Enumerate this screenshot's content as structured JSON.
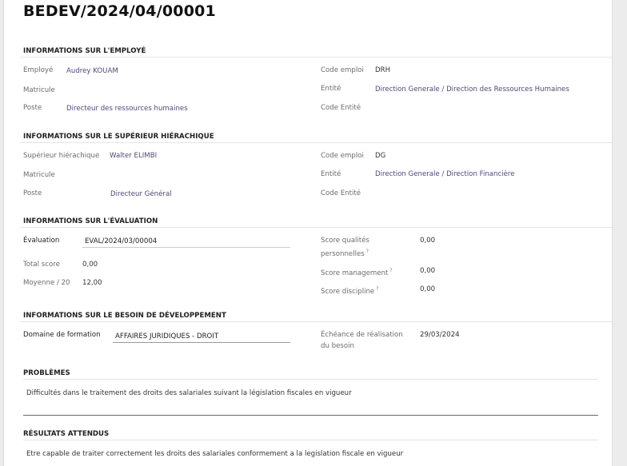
{
  "record_title": "BEDEV/2024/04/00001",
  "employee": {
    "heading": "INFORMATIONS SUR L'EMPLOYÉ",
    "employe_label": "Employé",
    "employe_value": "Audrey KOUAM",
    "matricule_label": "Matricule",
    "poste_label": "Poste",
    "poste_value": "Directeur des ressources humaines",
    "code_emploi_label": "Code emploi",
    "code_emploi_value": "DRH",
    "entite_label": "Entité",
    "entite_value": "Direction Generale / Direction des Ressources Humaines",
    "code_entite_label": "Code Entité"
  },
  "superior": {
    "heading": "INFORMATIONS SUR LE SUPÉRIEUR HIÉRACHIQUE",
    "sup_label": "Supérieur hiérachique",
    "sup_value": "Walter ELIMBI",
    "matricule_label": "Matricule",
    "poste_label": "Poste",
    "poste_value": "Directeur Général",
    "code_emploi_label": "Code emploi",
    "code_emploi_value": "DG",
    "entite_label": "Entité",
    "entite_value": "Direction Generale / Direction Financière",
    "code_entite_label": "Code Entité"
  },
  "evaluation": {
    "heading": "INFORMATIONS SUR L'ÉVALUATION",
    "eval_label": "Évaluation",
    "eval_value": "EVAL/2024/03/00004",
    "total_label": "Total score",
    "total_value": "0,00",
    "moyenne_label": "Moyenne / 20",
    "moyenne_value": "12,00",
    "qualites_label_1": "Score qualités",
    "qualites_label_2": "personnelles",
    "qualites_value": "0,00",
    "management_label": "Score management",
    "management_value": "0,00",
    "discipline_label": "Score discipline",
    "discipline_value": "0,00",
    "help_mark": "?"
  },
  "besoin": {
    "heading": "INFORMATIONS SUR LE BESOIN DE DÉVELOPPEMENT",
    "domaine_label": "Domaine de formation",
    "domaine_value": "AFFAIRES JURIDIQUES - DROIT",
    "echeance_label_1": "Échéance de réalisation",
    "echeance_label_2": "du besoin",
    "echeance_value": "29/03/2024"
  },
  "problemes": {
    "heading": "PROBLÈMES",
    "text": "Difficultés dans le traitement des droits des salariales suivant la législation fiscales en vigueur"
  },
  "resultats": {
    "heading": "RÉSULTATS ATTENDUS",
    "text": "Etre capable de traiter correctement les droits des salariales conformement a la legislation fiscale en vigueur"
  }
}
